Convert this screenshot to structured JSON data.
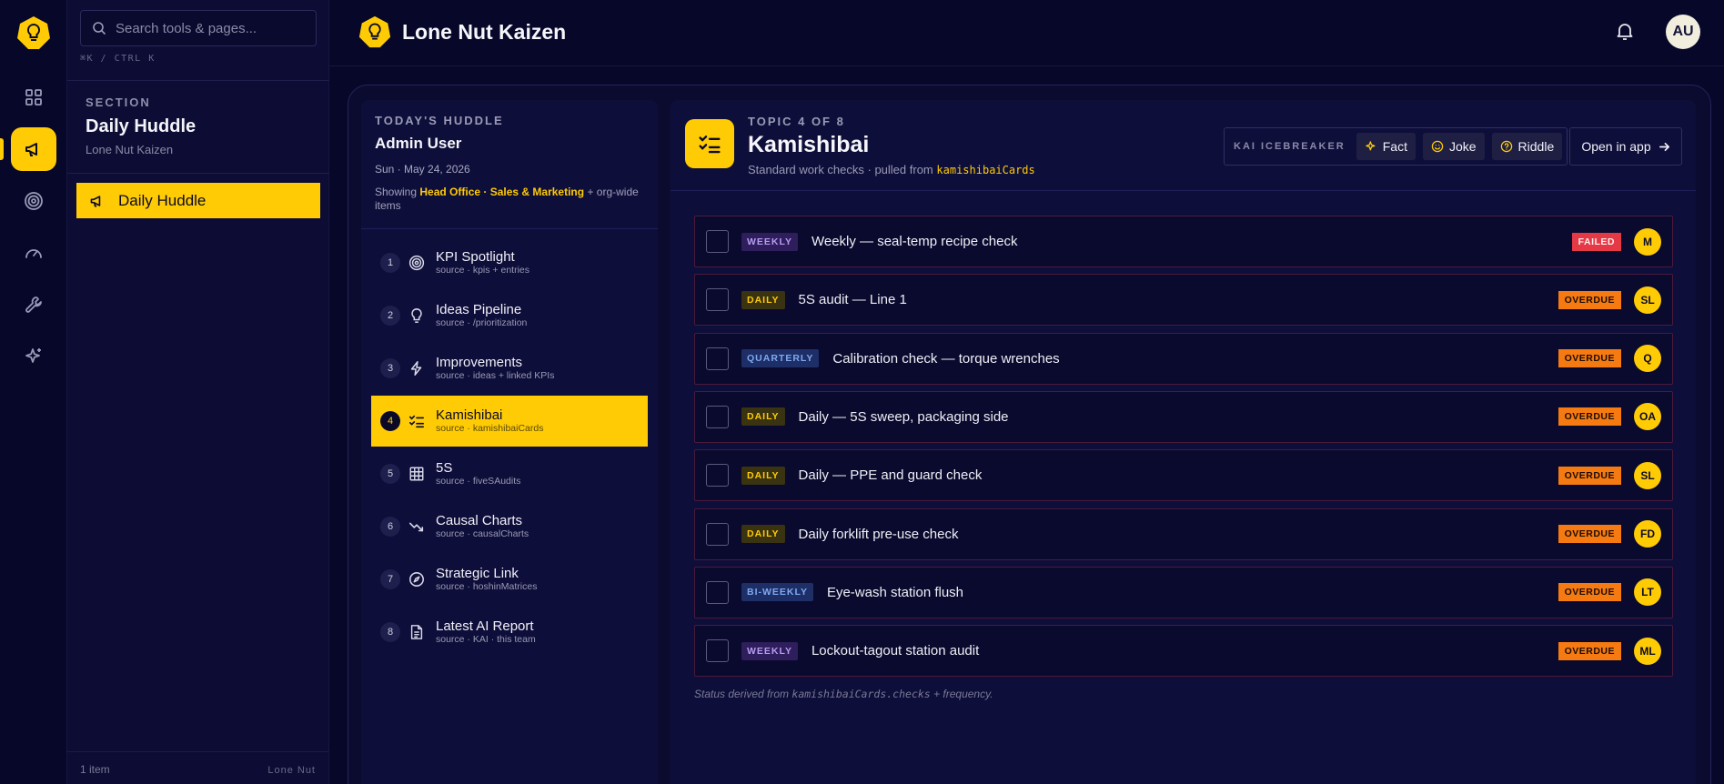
{
  "rail": {
    "items": [
      {
        "icon": "grid-icon",
        "active": false
      },
      {
        "icon": "megaphone-icon",
        "active": true
      },
      {
        "icon": "target-icon",
        "active": false
      },
      {
        "icon": "gauge-icon",
        "active": false
      },
      {
        "icon": "wrench-icon",
        "active": false
      },
      {
        "icon": "sparkles-icon",
        "active": false
      }
    ]
  },
  "sidebar": {
    "search_placeholder": "Search tools & pages...",
    "shortcut": "⌘K / CTRL K",
    "section_eyebrow": "SECTION",
    "section_title": "Daily Huddle",
    "section_sub": "Lone Nut Kaizen",
    "items": [
      {
        "label": "Daily Huddle",
        "icon": "megaphone-icon",
        "active": true
      }
    ],
    "footer_count": "1 item",
    "footer_brand": "Lone Nut"
  },
  "topbar": {
    "title": "Lone Nut Kaizen",
    "avatar": "AU"
  },
  "huddle": {
    "eyebrow": "TODAY'S HUDDLE",
    "user": "Admin User",
    "date": "Sun · May 24, 2026",
    "showing_prefix": "Showing",
    "showing_teams": "Head Office · Sales & Marketing",
    "showing_suffix": "+ org-wide items",
    "topics": [
      {
        "num": "1",
        "title": "KPI Spotlight",
        "source": "source · kpis + entries",
        "icon": "target-icon"
      },
      {
        "num": "2",
        "title": "Ideas Pipeline",
        "source": "source · /prioritization",
        "icon": "lightbulb-icon"
      },
      {
        "num": "3",
        "title": "Improvements",
        "source": "source · ideas + linked KPIs",
        "icon": "lightning-icon"
      },
      {
        "num": "4",
        "title": "Kamishibai",
        "source": "source · kamishibaiCards",
        "icon": "checklist-icon"
      },
      {
        "num": "5",
        "title": "5S",
        "source": "source · fiveSAudits",
        "icon": "grid-table-icon"
      },
      {
        "num": "6",
        "title": "Causal Charts",
        "source": "source · causalCharts",
        "icon": "trend-down-icon"
      },
      {
        "num": "7",
        "title": "Strategic Link",
        "source": "source · hoshinMatrices",
        "icon": "compass-icon"
      },
      {
        "num": "8",
        "title": "Latest AI Report",
        "source": "source · KAI · this team",
        "icon": "document-icon"
      }
    ]
  },
  "content": {
    "eyebrow": "TOPIC 4 OF 8",
    "title": "Kamishibai",
    "sub_prefix": "Standard work checks · pulled from",
    "sub_code": "kamishibaiCards",
    "icebreaker_label": "KAI ICEBREAKER",
    "icebreaker_buttons": [
      "Fact",
      "Joke",
      "Riddle"
    ],
    "open_app": "Open in app",
    "checks": [
      {
        "freq": "WEEKLY",
        "freq_class": "b-weekly",
        "title": "Weekly — seal-temp recipe check",
        "status": "FAILED",
        "status_class": "s-failed",
        "owner": "M"
      },
      {
        "freq": "DAILY",
        "freq_class": "b-daily",
        "title": "5S audit — Line 1",
        "status": "OVERDUE",
        "status_class": "s-overdue",
        "owner": "SL"
      },
      {
        "freq": "QUARTERLY",
        "freq_class": "b-quarterly",
        "title": "Calibration check — torque wrenches",
        "status": "OVERDUE",
        "status_class": "s-overdue",
        "owner": "Q"
      },
      {
        "freq": "DAILY",
        "freq_class": "b-daily",
        "title": "Daily — 5S sweep, packaging side",
        "status": "OVERDUE",
        "status_class": "s-overdue",
        "owner": "OA"
      },
      {
        "freq": "DAILY",
        "freq_class": "b-daily",
        "title": "Daily — PPE and guard check",
        "status": "OVERDUE",
        "status_class": "s-overdue",
        "owner": "SL"
      },
      {
        "freq": "DAILY",
        "freq_class": "b-daily",
        "title": "Daily forklift pre-use check",
        "status": "OVERDUE",
        "status_class": "s-overdue",
        "owner": "FD"
      },
      {
        "freq": "BI-WEEKLY",
        "freq_class": "b-biweekly",
        "title": "Eye-wash station flush",
        "status": "OVERDUE",
        "status_class": "s-overdue",
        "owner": "LT"
      },
      {
        "freq": "WEEKLY",
        "freq_class": "b-weekly",
        "title": "Lockout-tagout station audit",
        "status": "OVERDUE",
        "status_class": "s-overdue",
        "owner": "ML"
      }
    ],
    "footer_prefix": "Status derived from",
    "footer_code": "kamishibaiCards.checks",
    "footer_suffix": "+ frequency."
  },
  "colors": {
    "accent": "#ffcb05",
    "bg": "#07072a",
    "failed": "#e53946",
    "overdue": "#f57a12"
  }
}
